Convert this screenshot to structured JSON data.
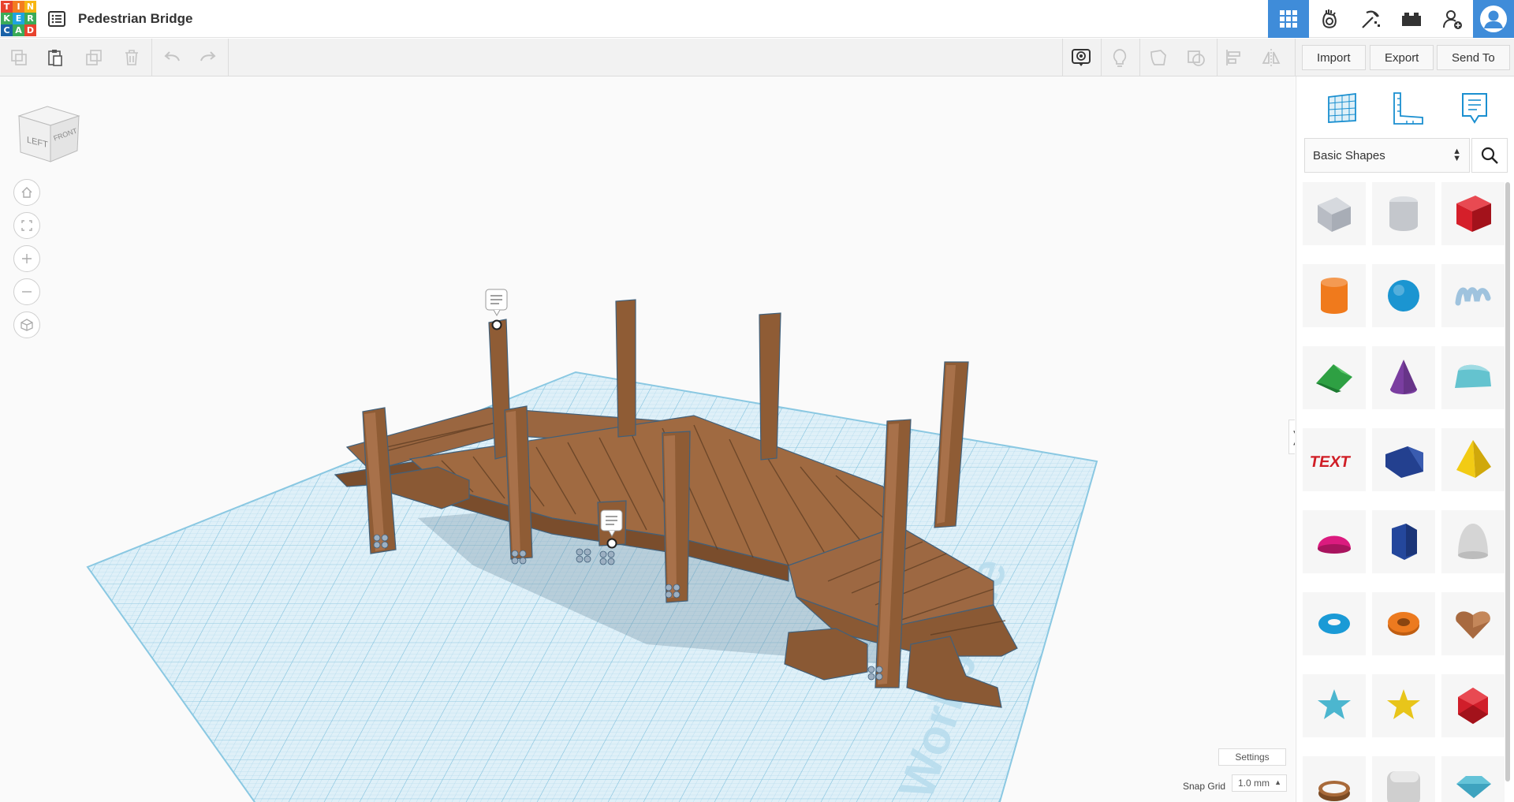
{
  "header": {
    "logo_letters": [
      "T",
      "I",
      "N",
      "K",
      "E",
      "R",
      "C",
      "A",
      "D"
    ],
    "logo_colors": [
      "#e8432e",
      "#f37c20",
      "#f7b614",
      "#3aab58",
      "#1fa3df",
      "#3aab58",
      "#1a62a8",
      "#3aab58",
      "#e8432e"
    ],
    "document_title": "Pedestrian Bridge",
    "nav_icons": [
      "3d-design-icon",
      "circuits-icon",
      "minecraft-icon",
      "lego-bricks-icon",
      "add-user-icon",
      "user-avatar-icon"
    ]
  },
  "toolbar": {
    "left_icons": [
      "copy-icon",
      "paste-icon",
      "duplicate-icon",
      "delete-icon",
      "undo-icon",
      "redo-icon"
    ],
    "right_icons": [
      "notes-icon",
      "lightbulb-icon",
      "workplane-icon",
      "group-icon",
      "align-icon",
      "mirror-icon"
    ],
    "import_label": "Import",
    "export_label": "Export",
    "send_to_label": "Send To"
  },
  "viewcube": {
    "left_label": "LEFT",
    "front_label": "FRONT"
  },
  "view_controls": [
    "home-view-icon",
    "fit-all-icon",
    "zoom-in-icon",
    "zoom-out-icon",
    "perspective-icon"
  ],
  "workplane": {
    "watermark": "Workplane",
    "settings_label": "Settings",
    "snap_grid_label": "Snap Grid",
    "snap_grid_value": "1.0 mm"
  },
  "panel": {
    "tabs": [
      "workplane-grid-icon",
      "ruler-icon",
      "notes-icon"
    ],
    "category_value": "Basic Shapes",
    "shapes": [
      {
        "name": "box-hole",
        "color": "#b8bcc4"
      },
      {
        "name": "cylinder-hole",
        "color": "#c4c7cc"
      },
      {
        "name": "box",
        "color": "#d51f2a"
      },
      {
        "name": "cylinder",
        "color": "#f07a1c"
      },
      {
        "name": "sphere",
        "color": "#1b95d1"
      },
      {
        "name": "scribble",
        "color": "#9fc3de"
      },
      {
        "name": "roof",
        "color": "#2ea043"
      },
      {
        "name": "cone",
        "color": "#7a3ea0"
      },
      {
        "name": "round-roof",
        "color": "#64c3cf"
      },
      {
        "name": "text",
        "color": "#d01e26"
      },
      {
        "name": "wedge",
        "color": "#23408f"
      },
      {
        "name": "pyramid",
        "color": "#f2cb14"
      },
      {
        "name": "half-sphere",
        "color": "#db1b7f"
      },
      {
        "name": "polygon",
        "color": "#24479c"
      },
      {
        "name": "paraboloid",
        "color": "#d5d5d5"
      },
      {
        "name": "torus",
        "color": "#1a9ad6"
      },
      {
        "name": "tube",
        "color": "#ec7a1f"
      },
      {
        "name": "heart",
        "color": "#a86a40"
      },
      {
        "name": "star",
        "color": "#4cb6cf"
      },
      {
        "name": "star-yellow",
        "color": "#e8c51a"
      },
      {
        "name": "icosahedron",
        "color": "#d01e2a"
      },
      {
        "name": "ring",
        "color": "#a86a3a"
      },
      {
        "name": "rounded-box",
        "color": "#cfcfcf"
      },
      {
        "name": "diamond",
        "color": "#64c3d8"
      }
    ]
  },
  "colors": {
    "accent": "#3f8cd9",
    "wood": "#8b5a36",
    "wood_light": "#a56b41",
    "grid": "#b8dff0"
  }
}
